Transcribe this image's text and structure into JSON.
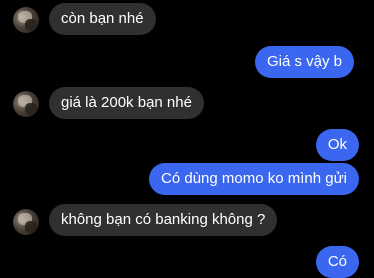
{
  "colors": {
    "background": "#000000",
    "incoming_bubble": "#303030",
    "outgoing_bubble": "#3a66f0",
    "text": "#ffffff"
  },
  "messages": [
    {
      "direction": "incoming",
      "text": "còn bạn nhé",
      "avatar": "contact-avatar"
    },
    {
      "direction": "outgoing",
      "text": "Giá s vậy b"
    },
    {
      "direction": "incoming",
      "text": "giá là 200k bạn nhé",
      "avatar": "contact-avatar"
    },
    {
      "direction": "outgoing",
      "text": "Ok"
    },
    {
      "direction": "outgoing",
      "text": "Có dùng momo ko mình gửi"
    },
    {
      "direction": "incoming",
      "text": "không bạn có banking không ?",
      "avatar": "contact-avatar"
    },
    {
      "direction": "outgoing",
      "text": "Có"
    }
  ]
}
